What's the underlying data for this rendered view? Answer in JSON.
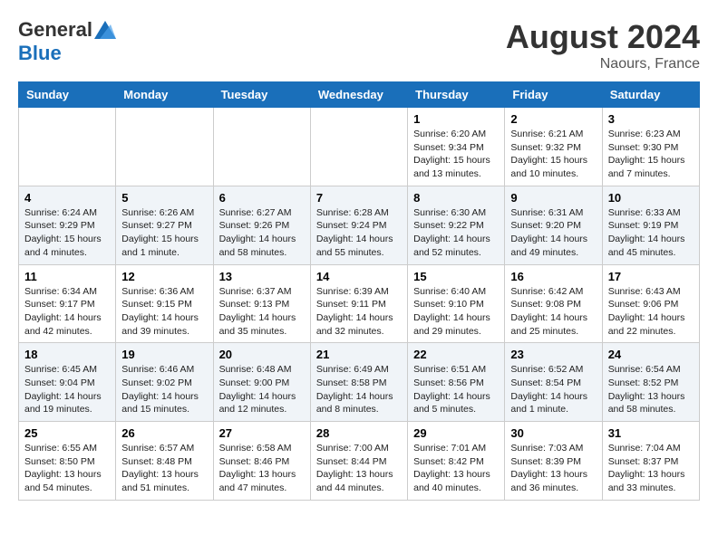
{
  "header": {
    "logo_general": "General",
    "logo_blue": "Blue",
    "month_year": "August 2024",
    "location": "Naours, France"
  },
  "days_of_week": [
    "Sunday",
    "Monday",
    "Tuesday",
    "Wednesday",
    "Thursday",
    "Friday",
    "Saturday"
  ],
  "weeks": [
    [
      {
        "day": "",
        "detail": ""
      },
      {
        "day": "",
        "detail": ""
      },
      {
        "day": "",
        "detail": ""
      },
      {
        "day": "",
        "detail": ""
      },
      {
        "day": "1",
        "detail": "Sunrise: 6:20 AM\nSunset: 9:34 PM\nDaylight: 15 hours\nand 13 minutes."
      },
      {
        "day": "2",
        "detail": "Sunrise: 6:21 AM\nSunset: 9:32 PM\nDaylight: 15 hours\nand 10 minutes."
      },
      {
        "day": "3",
        "detail": "Sunrise: 6:23 AM\nSunset: 9:30 PM\nDaylight: 15 hours\nand 7 minutes."
      }
    ],
    [
      {
        "day": "4",
        "detail": "Sunrise: 6:24 AM\nSunset: 9:29 PM\nDaylight: 15 hours\nand 4 minutes."
      },
      {
        "day": "5",
        "detail": "Sunrise: 6:26 AM\nSunset: 9:27 PM\nDaylight: 15 hours\nand 1 minute."
      },
      {
        "day": "6",
        "detail": "Sunrise: 6:27 AM\nSunset: 9:26 PM\nDaylight: 14 hours\nand 58 minutes."
      },
      {
        "day": "7",
        "detail": "Sunrise: 6:28 AM\nSunset: 9:24 PM\nDaylight: 14 hours\nand 55 minutes."
      },
      {
        "day": "8",
        "detail": "Sunrise: 6:30 AM\nSunset: 9:22 PM\nDaylight: 14 hours\nand 52 minutes."
      },
      {
        "day": "9",
        "detail": "Sunrise: 6:31 AM\nSunset: 9:20 PM\nDaylight: 14 hours\nand 49 minutes."
      },
      {
        "day": "10",
        "detail": "Sunrise: 6:33 AM\nSunset: 9:19 PM\nDaylight: 14 hours\nand 45 minutes."
      }
    ],
    [
      {
        "day": "11",
        "detail": "Sunrise: 6:34 AM\nSunset: 9:17 PM\nDaylight: 14 hours\nand 42 minutes."
      },
      {
        "day": "12",
        "detail": "Sunrise: 6:36 AM\nSunset: 9:15 PM\nDaylight: 14 hours\nand 39 minutes."
      },
      {
        "day": "13",
        "detail": "Sunrise: 6:37 AM\nSunset: 9:13 PM\nDaylight: 14 hours\nand 35 minutes."
      },
      {
        "day": "14",
        "detail": "Sunrise: 6:39 AM\nSunset: 9:11 PM\nDaylight: 14 hours\nand 32 minutes."
      },
      {
        "day": "15",
        "detail": "Sunrise: 6:40 AM\nSunset: 9:10 PM\nDaylight: 14 hours\nand 29 minutes."
      },
      {
        "day": "16",
        "detail": "Sunrise: 6:42 AM\nSunset: 9:08 PM\nDaylight: 14 hours\nand 25 minutes."
      },
      {
        "day": "17",
        "detail": "Sunrise: 6:43 AM\nSunset: 9:06 PM\nDaylight: 14 hours\nand 22 minutes."
      }
    ],
    [
      {
        "day": "18",
        "detail": "Sunrise: 6:45 AM\nSunset: 9:04 PM\nDaylight: 14 hours\nand 19 minutes."
      },
      {
        "day": "19",
        "detail": "Sunrise: 6:46 AM\nSunset: 9:02 PM\nDaylight: 14 hours\nand 15 minutes."
      },
      {
        "day": "20",
        "detail": "Sunrise: 6:48 AM\nSunset: 9:00 PM\nDaylight: 14 hours\nand 12 minutes."
      },
      {
        "day": "21",
        "detail": "Sunrise: 6:49 AM\nSunset: 8:58 PM\nDaylight: 14 hours\nand 8 minutes."
      },
      {
        "day": "22",
        "detail": "Sunrise: 6:51 AM\nSunset: 8:56 PM\nDaylight: 14 hours\nand 5 minutes."
      },
      {
        "day": "23",
        "detail": "Sunrise: 6:52 AM\nSunset: 8:54 PM\nDaylight: 14 hours\nand 1 minute."
      },
      {
        "day": "24",
        "detail": "Sunrise: 6:54 AM\nSunset: 8:52 PM\nDaylight: 13 hours\nand 58 minutes."
      }
    ],
    [
      {
        "day": "25",
        "detail": "Sunrise: 6:55 AM\nSunset: 8:50 PM\nDaylight: 13 hours\nand 54 minutes."
      },
      {
        "day": "26",
        "detail": "Sunrise: 6:57 AM\nSunset: 8:48 PM\nDaylight: 13 hours\nand 51 minutes."
      },
      {
        "day": "27",
        "detail": "Sunrise: 6:58 AM\nSunset: 8:46 PM\nDaylight: 13 hours\nand 47 minutes."
      },
      {
        "day": "28",
        "detail": "Sunrise: 7:00 AM\nSunset: 8:44 PM\nDaylight: 13 hours\nand 44 minutes."
      },
      {
        "day": "29",
        "detail": "Sunrise: 7:01 AM\nSunset: 8:42 PM\nDaylight: 13 hours\nand 40 minutes."
      },
      {
        "day": "30",
        "detail": "Sunrise: 7:03 AM\nSunset: 8:39 PM\nDaylight: 13 hours\nand 36 minutes."
      },
      {
        "day": "31",
        "detail": "Sunrise: 7:04 AM\nSunset: 8:37 PM\nDaylight: 13 hours\nand 33 minutes."
      }
    ]
  ]
}
